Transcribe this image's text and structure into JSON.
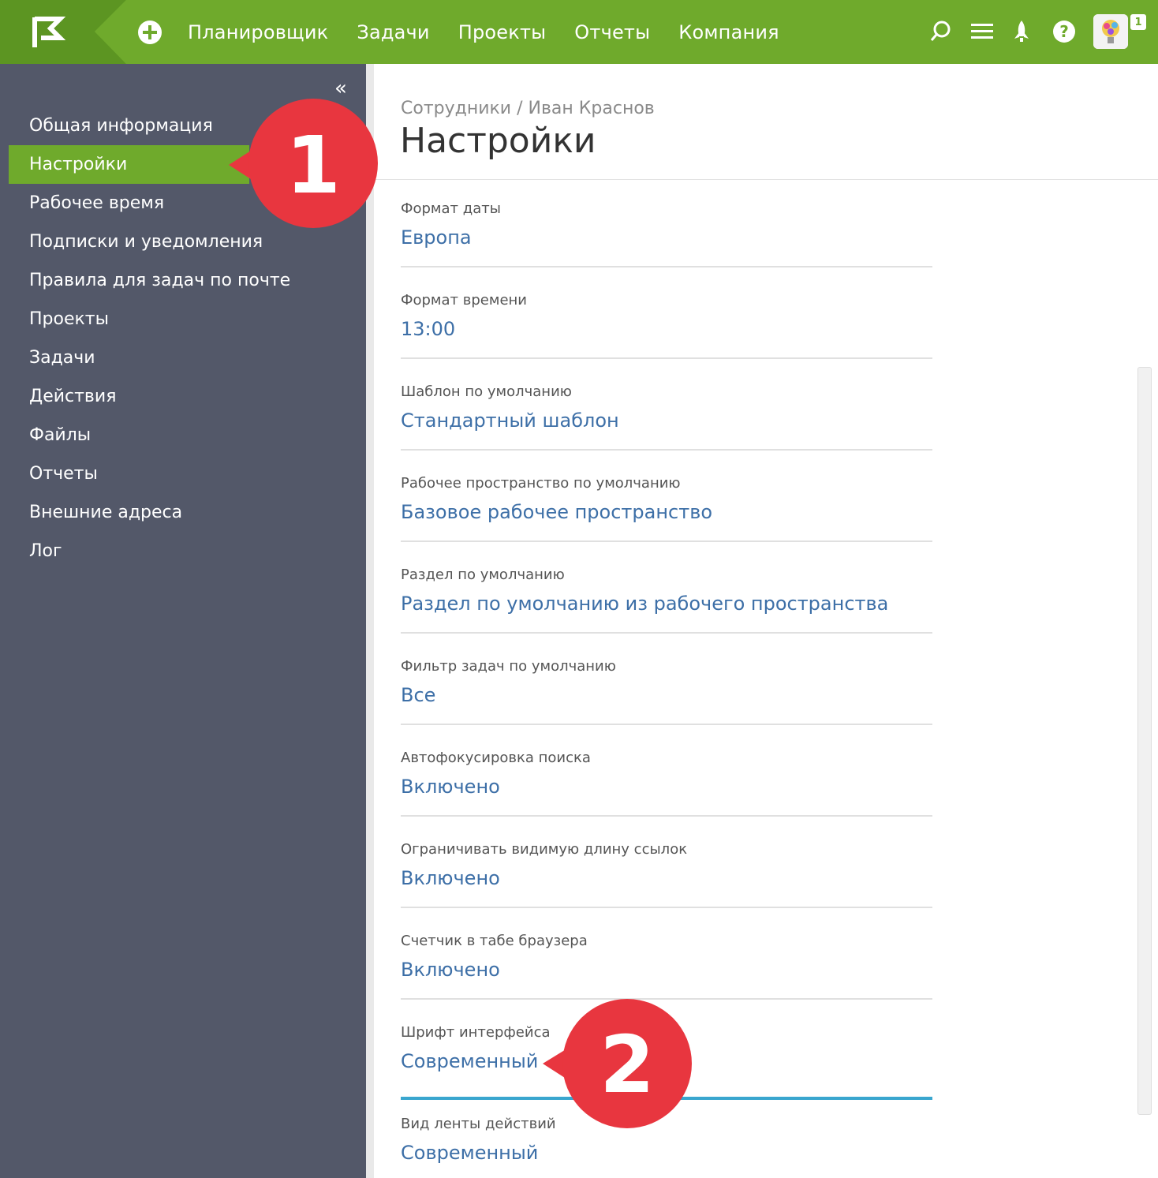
{
  "topbar": {
    "nav": [
      "Планировщик",
      "Задачи",
      "Проекты",
      "Отчеты",
      "Компания"
    ],
    "badge": "1",
    "brand_color": "#6faa2c"
  },
  "sidebar": {
    "collapse_glyph": "«",
    "items": [
      {
        "label": "Общая информация"
      },
      {
        "label": "Настройки"
      },
      {
        "label": "Рабочее время"
      },
      {
        "label": "Подписки и уведомления"
      },
      {
        "label": "Правила для задач по почте"
      },
      {
        "label": "Проекты"
      },
      {
        "label": "Задачи"
      },
      {
        "label": "Действия"
      },
      {
        "label": "Файлы"
      },
      {
        "label": "Отчеты"
      },
      {
        "label": "Внешние адреса"
      },
      {
        "label": "Лог"
      }
    ]
  },
  "main": {
    "breadcrumb": "Сотрудники / Иван Краснов",
    "title": "Настройки",
    "fields": [
      {
        "label": "Формат даты",
        "value": "Европа"
      },
      {
        "label": "Формат времени",
        "value": "13:00"
      },
      {
        "label": "Шаблон по умолчанию",
        "value": "Стандартный шаблон"
      },
      {
        "label": "Рабочее пространство по умолчанию",
        "value": "Базовое рабочее пространство"
      },
      {
        "label": "Раздел по умолчанию",
        "value": "Раздел по умолчанию из рабочего пространства"
      },
      {
        "label": "Фильтр задач по умолчанию",
        "value": "Все"
      },
      {
        "label": "Автофокусировка поиска",
        "value": "Включено"
      },
      {
        "label": "Ограничивать видимую длину ссылок",
        "value": "Включено"
      },
      {
        "label": "Счетчик в табе браузера",
        "value": "Включено"
      },
      {
        "label": "Шрифт интерфейса",
        "value": "Современный"
      },
      {
        "label": "Вид ленты действий",
        "value": "Современный"
      }
    ]
  },
  "callouts": {
    "first": "1",
    "second": "2",
    "color": "#e8363f"
  }
}
